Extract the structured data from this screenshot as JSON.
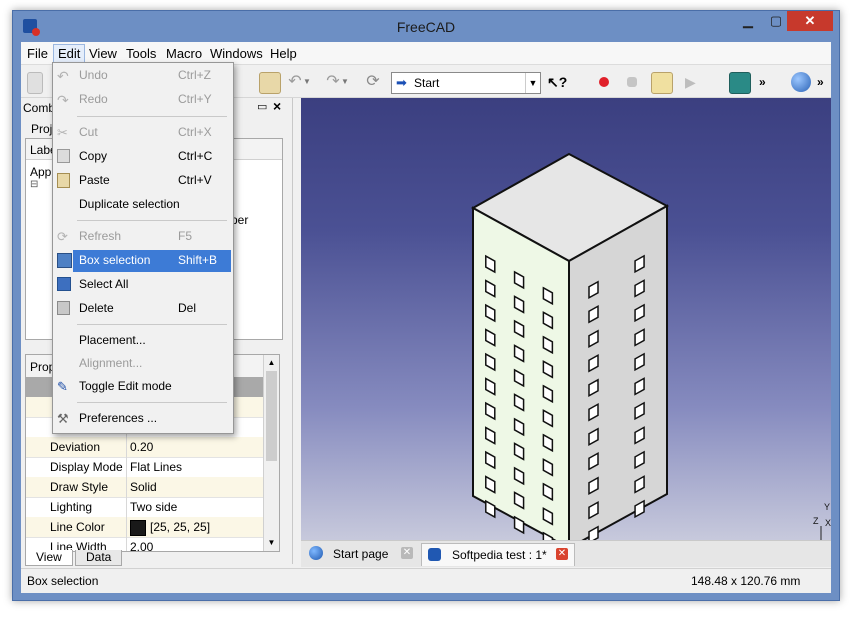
{
  "window": {
    "title": "FreeCAD"
  },
  "menubar": [
    "File",
    "Edit",
    "View",
    "Tools",
    "Macro",
    "Windows",
    "Help"
  ],
  "toolbar": {
    "workbench": "Start"
  },
  "combo_view": {
    "title": "Combo",
    "tab": "Proj",
    "tree_header": "Labe",
    "tree_rows": [
      "App",
      "per"
    ]
  },
  "properties": {
    "header": "Prop",
    "rows": [
      {
        "name": "Deviation",
        "value": "0.20"
      },
      {
        "name": "Display Mode",
        "value": "Flat Lines"
      },
      {
        "name": "Draw Style",
        "value": "Solid"
      },
      {
        "name": "Lighting",
        "value": "Two side"
      },
      {
        "name": "Line Color",
        "value": "[25, 25, 25]"
      },
      {
        "name": "Line Width",
        "value": "2.00"
      }
    ]
  },
  "bottom_tabs": [
    "View",
    "Data"
  ],
  "edit_menu": {
    "undo": {
      "label": "Undo",
      "shortcut": "Ctrl+Z"
    },
    "redo": {
      "label": "Redo",
      "shortcut": "Ctrl+Y"
    },
    "cut": {
      "label": "Cut",
      "shortcut": "Ctrl+X"
    },
    "copy": {
      "label": "Copy",
      "shortcut": "Ctrl+C"
    },
    "paste": {
      "label": "Paste",
      "shortcut": "Ctrl+V"
    },
    "duplicate": {
      "label": "Duplicate selection"
    },
    "refresh": {
      "label": "Refresh",
      "shortcut": "F5"
    },
    "box_selection": {
      "label": "Box selection",
      "shortcut": "Shift+B"
    },
    "select_all": {
      "label": "Select All"
    },
    "delete": {
      "label": "Delete",
      "shortcut": "Del"
    },
    "placement": {
      "label": "Placement..."
    },
    "alignment": {
      "label": "Alignment..."
    },
    "toggle_edit": {
      "label": "Toggle Edit mode"
    },
    "preferences": {
      "label": "Preferences ..."
    }
  },
  "viewport": {
    "axes": {
      "y": "Y",
      "z": "Z",
      "x": "X"
    }
  },
  "doc_tabs": [
    {
      "label": "Start page"
    },
    {
      "label": "Softpedia test : 1*"
    }
  ],
  "status": {
    "message": "Box selection",
    "dimensions": "148.48 x 120.76 mm"
  },
  "colors": {
    "highlight": "#3d7bd6",
    "building_side_light": "#eef8e6",
    "building_side_dark": "#d6d6d6",
    "building_top": "#e6e6e6"
  }
}
